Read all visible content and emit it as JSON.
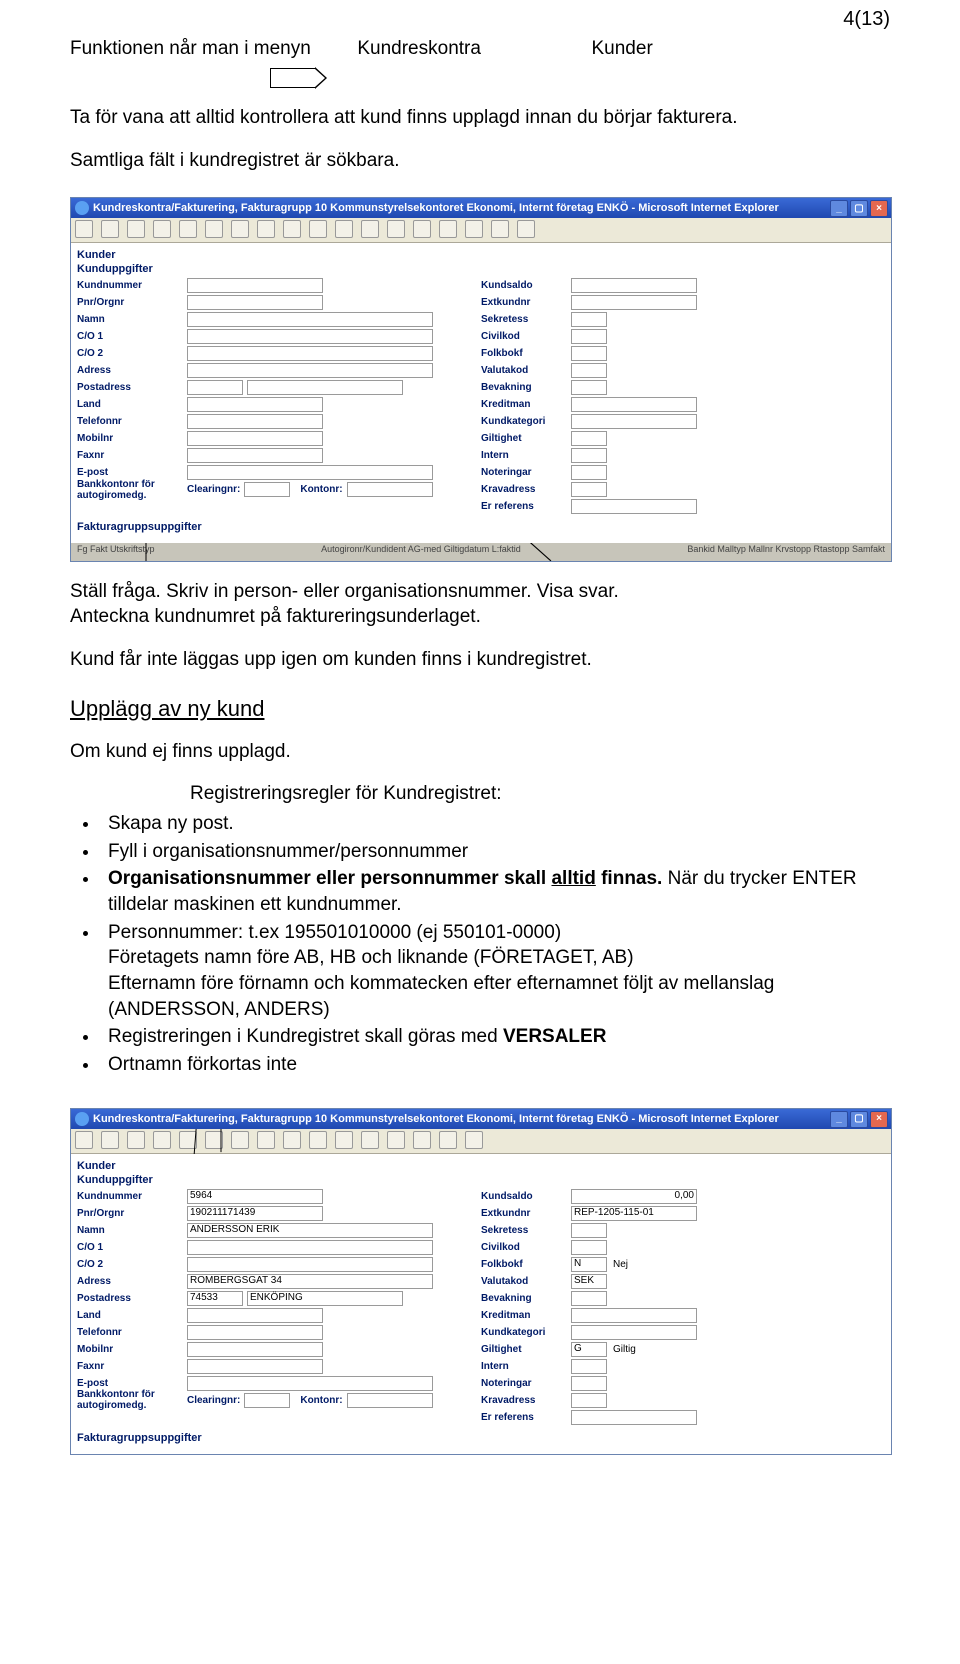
{
  "page_number": "4(13)",
  "line1": {
    "a": "Funktionen når man i menyn",
    "b": "Kundreskontra",
    "c": "Kunder"
  },
  "para1": "Ta för vana att alltid kontrollera att kund finns upplagd innan du börjar fakturera.",
  "para2": "Samtliga fält i kundregistret är sökbara.",
  "win1": {
    "title": "Kundreskontra/Fakturering, Fakturagrupp 10 Kommunstyrelsekontoret Ekonomi, Internt företag ENKÖ - Microsoft Internet Explorer",
    "section1": "Kunder",
    "section2": "Kunduppgifter",
    "section3": "Fakturagruppsuppgifter",
    "left_labels": [
      "Kundnummer",
      "Pnr/Orgnr",
      "Namn",
      "C/O 1",
      "C/O 2",
      "Adress",
      "Postadress",
      "Land",
      "Telefonnr",
      "Mobilnr",
      "Faxnr",
      "E-post"
    ],
    "bank_label": "Bankkontonr för autogiromedg.",
    "bank_sub1": "Clearingnr:",
    "bank_sub2": "Kontonr:",
    "right_labels": [
      "Kundsaldo",
      "Extkundnr",
      "Sekretess",
      "Civilkod",
      "Folkbokf",
      "Valutakod",
      "Bevakning",
      "Kreditman",
      "Kundkategori",
      "Giltighet",
      "Intern",
      "Noteringar",
      "Kravadress",
      "Er referens"
    ],
    "bottom_left": "Fg  Fakt Utskriftstyp",
    "bottom_mid": "Autogironr/Kundident AG-med Giltigdatum L:faktid",
    "bottom_right": "Bankid Malltyp Mallnr Krvstopp Rtastopp Samfakt"
  },
  "mid_text": {
    "l1": "Ställ fråga. Skriv in person- eller organisationsnummer. Visa svar.",
    "l2": "Anteckna kundnumret på faktureringsunderlaget.",
    "l3": "Kund får inte läggas upp igen om kunden finns i kundregistret."
  },
  "heading_upplagg": "Upplägg av ny kund",
  "om_line": "Om kund ej finns upplagd.",
  "reg_rules_hdr": "Registreringsregler för Kundregistret:",
  "bullets": {
    "b1": "Skapa ny post.",
    "b2": "Fyll i organisationsnummer/personnummer",
    "b3a": "Organisationsnummer eller personnummer skall ",
    "b3u": "alltid",
    "b3b": " finnas.",
    "b3c": " När du trycker ENTER tilldelar maskinen ett kundnummer.",
    "b4": "Personnummer: t.ex 195501010000 (ej 550101-0000)",
    "b4l2": "Företagets namn före AB, HB och liknande (FÖRETAGET, AB)",
    "b4l3": "Efternamn före förnamn och kommatecken efter efternamnet följt av mellanslag (ANDERSSON, ANDERS)",
    "b5a": "Registreringen i Kundregistret skall göras med ",
    "b5b": "VERSALER",
    "b6": "Ortnamn förkortas inte"
  },
  "win2": {
    "title": "Kundreskontra/Fakturering, Fakturagrupp 10 Kommunstyrelsekontoret Ekonomi, Internt företag ENKÖ - Microsoft Internet Explorer",
    "left_values": {
      "Kundnummer": "5964",
      "Pnr/Orgnr": "190211171439",
      "Namn": "ANDERSSON ERIK",
      "C/O 1": "",
      "C/O 2": "",
      "Adress": "ROMBERGSGAT 34",
      "Postadress_a": "74533",
      "Postadress_b": "ENKÖPING",
      "Land": "",
      "Telefonnr": "",
      "Mobilnr": "",
      "Faxnr": "",
      "E-post": ""
    },
    "right_values": {
      "Kundsaldo": "0,00",
      "Extkundnr": "REP-1205-115-01",
      "Sekretess": "",
      "Civilkod": "",
      "Folkbokf_a": "N",
      "Folkbokf_b": "Nej",
      "Valutakod": "SEK",
      "Bevakning": "",
      "Kreditman": "",
      "Kundkategori": "",
      "Giltighet_a": "G",
      "Giltighet_b": "Giltig",
      "Intern": "",
      "Noteringar": "",
      "Kravadress": "",
      "Er referens": ""
    }
  }
}
